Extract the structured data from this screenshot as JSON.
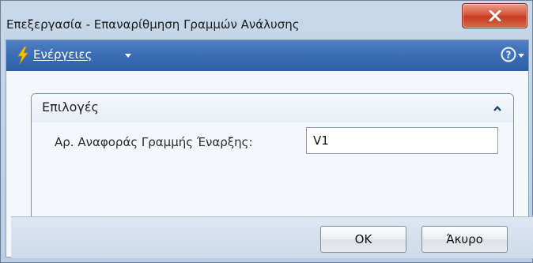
{
  "window": {
    "title": "Επεξεργασία - Επαναρίθμηση Γραμμών Ανάλυσης",
    "close_icon": "close-icon"
  },
  "actionbar": {
    "actions_label": "Ενέργειες",
    "actions_icon": "lightning-bolt-icon",
    "help_icon": "help-icon"
  },
  "fasttab": {
    "title": "Επιλογές",
    "expanded": true
  },
  "fields": {
    "start_line_label": "Αρ. Αναφοράς Γραμμής Έναρξης:",
    "start_line_value": "V1"
  },
  "footer": {
    "ok_label": "OK",
    "cancel_label": "Άκυρο"
  },
  "colors": {
    "actionbar": "#3b6db5",
    "close_button": "#c73a20",
    "window_frame": "#b9cde4"
  }
}
